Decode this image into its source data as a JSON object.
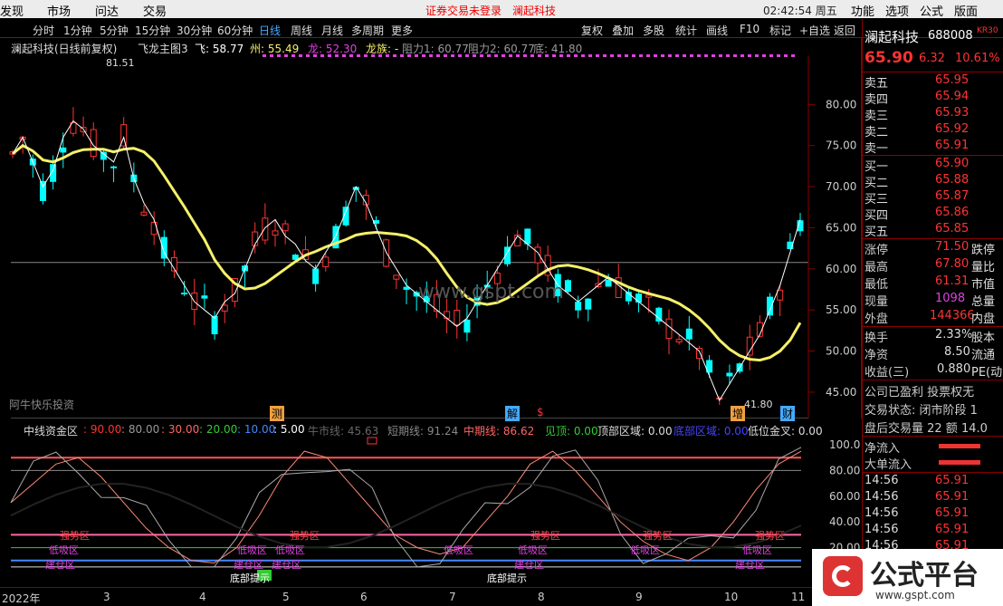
{
  "topmenu": {
    "items": [
      "发现",
      "市场",
      "问达",
      "交易"
    ],
    "login_notice": "证券交易未登录",
    "stock_name": "澜起科技",
    "time": "02:42:54 周五",
    "right": [
      "功能",
      "选项",
      "公式",
      "版面"
    ]
  },
  "toolbar": {
    "periods": [
      "分时",
      "1分钟",
      "5分钟",
      "15分钟",
      "30分钟",
      "60分钟",
      "日线",
      "周线",
      "月线",
      "多周期",
      "更多"
    ],
    "active_period": "日线",
    "buttons": [
      "复权",
      "叠加",
      "多股",
      "统计",
      "画线",
      "F10",
      "标记",
      "+自选",
      "返回"
    ]
  },
  "main": {
    "title": "澜起科技(日线前复权)",
    "indicator": "飞龙主图3",
    "fei": "飞: 58.77",
    "zhou": "州: 55.49",
    "long": "龙: 52.30",
    "longzu": "龙族: -",
    "zuli1": "阻力1: 60.77",
    "zuli2": "阻力2: 60.77",
    "di": "底: 41.80",
    "high_label": "81.51",
    "low_label": "41.80",
    "yticks": [
      "80.00",
      "75.00",
      "70.00",
      "65.00",
      "60.00",
      "55.00",
      "50.00",
      "45.00"
    ],
    "watermark": "www.gspt.com",
    "footer_text": "阿牛快乐投资",
    "markers": [
      "测",
      "解",
      "$",
      "增",
      "财"
    ]
  },
  "indicator": {
    "name": "中线资金区",
    "vals": [
      ": 90.00",
      ": 80.00",
      ": 30.00",
      ": 20.00",
      ": 10.00",
      ": 5.00"
    ],
    "niushi": "牛市线: 45.63",
    "duanqi": "短期线: 91.24",
    "zhongqi": "中期线: 86.62",
    "jianding": "见顶: 0.00",
    "dingbu": "顶部区域: 0.00",
    "dibu": "底部区域: 0.00",
    "dijin": "低位金叉: 0.00",
    "yticks": [
      "100.0",
      "80.00",
      "60.00",
      "40.00",
      "20.00"
    ],
    "zone_labels": [
      "强势区",
      "低吸区",
      "建仓区"
    ],
    "bottom_hint": "底部提示"
  },
  "xaxis": {
    "labels": [
      "2022年",
      "3",
      "4",
      "5",
      "6",
      "7",
      "8",
      "9",
      "10",
      "11"
    ]
  },
  "quote": {
    "name": "澜起科技",
    "code": "688008",
    "badge": "KR30",
    "price": "65.90",
    "change": "6.32",
    "pct": "10.61%",
    "asks": [
      {
        "label": "卖五",
        "price": "65.95"
      },
      {
        "label": "卖四",
        "price": "65.94"
      },
      {
        "label": "卖三",
        "price": "65.93"
      },
      {
        "label": "卖二",
        "price": "65.92"
      },
      {
        "label": "卖一",
        "price": "65.91"
      }
    ],
    "bids": [
      {
        "label": "买一",
        "price": "65.90"
      },
      {
        "label": "买二",
        "price": "65.88"
      },
      {
        "label": "买三",
        "price": "65.87"
      },
      {
        "label": "买四",
        "price": "65.86"
      },
      {
        "label": "买五",
        "price": "65.85"
      }
    ],
    "stats": [
      {
        "label": "涨停",
        "value": "71.50",
        "tail": "跌停"
      },
      {
        "label": "最高",
        "value": "67.80",
        "tail": "量比"
      },
      {
        "label": "最低",
        "value": "61.31",
        "tail": "市值"
      },
      {
        "label": "现量",
        "value": "1098",
        "tail": "总量"
      },
      {
        "label": "外盘",
        "value": "144366",
        "tail": "内盘"
      },
      {
        "label": "换手",
        "value": "2.33%",
        "tail": "股本"
      },
      {
        "label": "净资",
        "value": "8.50",
        "tail": "流通"
      },
      {
        "label": "收益(三)",
        "value": "0.880",
        "tail": "PE(动"
      }
    ],
    "info": [
      "公司已盈利 投票权无",
      "交易状态: 闭市阶段 1",
      "盘后交易量 22 额 14.0"
    ],
    "flows": [
      "净流入",
      "大单流入"
    ],
    "trades": [
      {
        "time": "14:56",
        "price": "65.91"
      },
      {
        "time": "14:56",
        "price": "65.91"
      },
      {
        "time": "14:56",
        "price": "65.91"
      },
      {
        "time": "14:56",
        "price": "65.91"
      },
      {
        "time": "14:56",
        "price": "65.91"
      }
    ]
  },
  "brand": {
    "name": "公式平台",
    "url": "www.gspt.com"
  },
  "colors": {
    "up": "#ff3333",
    "down": "#00ffff",
    "yellow": "#f5f06a",
    "magenta": "#e040e0"
  }
}
